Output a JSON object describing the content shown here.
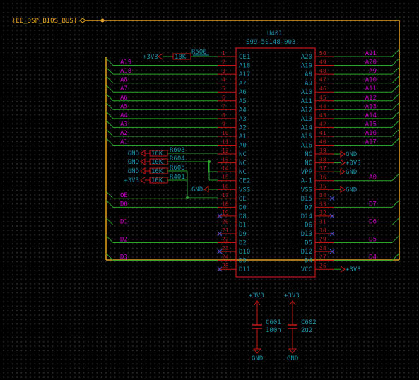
{
  "bus_label": "{EE_DSP_BIOS_BUS}",
  "ic": {
    "ref": "U401",
    "value": "S99-50148-003",
    "left_pins": [
      {
        "name": "CE1",
        "num": "1",
        "net": ""
      },
      {
        "name": "A18",
        "num": "2",
        "net": "A19"
      },
      {
        "name": "A17",
        "num": "3",
        "net": "A18"
      },
      {
        "name": "A7",
        "num": "4",
        "net": "A8"
      },
      {
        "name": "A6",
        "num": "5",
        "net": "A7"
      },
      {
        "name": "A5",
        "num": "6",
        "net": "A6"
      },
      {
        "name": "A4",
        "num": "7",
        "net": "A5"
      },
      {
        "name": "A3",
        "num": "8",
        "net": "A4"
      },
      {
        "name": "A2",
        "num": "9",
        "net": "A3"
      },
      {
        "name": "A1",
        "num": "10",
        "net": "A2"
      },
      {
        "name": "A0",
        "num": "11",
        "net": "A1"
      },
      {
        "name": "NC",
        "num": "12",
        "net": ""
      },
      {
        "name": "NC",
        "num": "13",
        "net": ""
      },
      {
        "name": "NC",
        "num": "14",
        "net": ""
      },
      {
        "name": "CE2",
        "num": "15",
        "net": ""
      },
      {
        "name": "VSS",
        "num": "16",
        "net": ""
      },
      {
        "name": "OE",
        "num": "17",
        "net": "OE"
      },
      {
        "name": "D0",
        "num": "18",
        "net": "D0"
      },
      {
        "name": "D8",
        "num": "19",
        "net": ""
      },
      {
        "name": "D1",
        "num": "20",
        "net": "D1"
      },
      {
        "name": "D9",
        "num": "21",
        "net": ""
      },
      {
        "name": "D2",
        "num": "22",
        "net": "D2"
      },
      {
        "name": "D10",
        "num": "23",
        "net": ""
      },
      {
        "name": "D3",
        "num": "24",
        "net": "D3"
      },
      {
        "name": "D11",
        "num": "25",
        "net": ""
      }
    ],
    "right_pins": [
      {
        "name": "A20",
        "num": "50",
        "net": "A21"
      },
      {
        "name": "A19",
        "num": "49",
        "net": "A20"
      },
      {
        "name": "A8",
        "num": "48",
        "net": "A9"
      },
      {
        "name": "A9",
        "num": "47",
        "net": "A10"
      },
      {
        "name": "A10",
        "num": "46",
        "net": "A11"
      },
      {
        "name": "A11",
        "num": "45",
        "net": "A12"
      },
      {
        "name": "A12",
        "num": "44",
        "net": "A13"
      },
      {
        "name": "A13",
        "num": "43",
        "net": "A14"
      },
      {
        "name": "A14",
        "num": "42",
        "net": "A15"
      },
      {
        "name": "A15",
        "num": "41",
        "net": "A16"
      },
      {
        "name": "A16",
        "num": "40",
        "net": "A17"
      },
      {
        "name": "NC",
        "num": "39",
        "net": ""
      },
      {
        "name": "NC",
        "num": "38",
        "net": ""
      },
      {
        "name": "VPP",
        "num": "37",
        "net": ""
      },
      {
        "name": "A-1",
        "num": "36",
        "net": "A0"
      },
      {
        "name": "VSS",
        "num": "35",
        "net": ""
      },
      {
        "name": "D15",
        "num": "34",
        "net": ""
      },
      {
        "name": "D7",
        "num": "33",
        "net": "D7"
      },
      {
        "name": "D14",
        "num": "32",
        "net": ""
      },
      {
        "name": "D6",
        "num": "31",
        "net": "D6"
      },
      {
        "name": "D13",
        "num": "30",
        "net": ""
      },
      {
        "name": "D5",
        "num": "29",
        "net": "D5"
      },
      {
        "name": "D12",
        "num": "28",
        "net": ""
      },
      {
        "name": "D4",
        "num": "27",
        "net": "D4"
      },
      {
        "name": "VCC",
        "num": "26",
        "net": ""
      }
    ]
  },
  "r506": {
    "ref": "R506",
    "value": "10K",
    "power": "+3V3"
  },
  "pullups": [
    {
      "ref": "R603",
      "value": "10K",
      "power": "GND"
    },
    {
      "ref": "R604",
      "value": "10K",
      "power": "GND"
    },
    {
      "ref": "R605",
      "value": "10K",
      "power": "GND"
    },
    {
      "ref": "R401",
      "value": "10K",
      "power": "+3V3"
    }
  ],
  "right_power": [
    {
      "pin": "39",
      "label": "GND"
    },
    {
      "pin": "38",
      "label": "+3V3"
    },
    {
      "pin": "37",
      "label": "GND"
    },
    {
      "pin": "35",
      "label": "GND"
    },
    {
      "pin": "26",
      "label": "+3V3"
    }
  ],
  "left_power": [
    {
      "pin": "16",
      "label": "GND"
    }
  ],
  "caps": [
    {
      "ref": "C601",
      "value": "100n",
      "top": "+3V3",
      "bottom": "GND"
    },
    {
      "ref": "C602",
      "value": "2u2",
      "top": "+3V3",
      "bottom": "GND"
    }
  ]
}
